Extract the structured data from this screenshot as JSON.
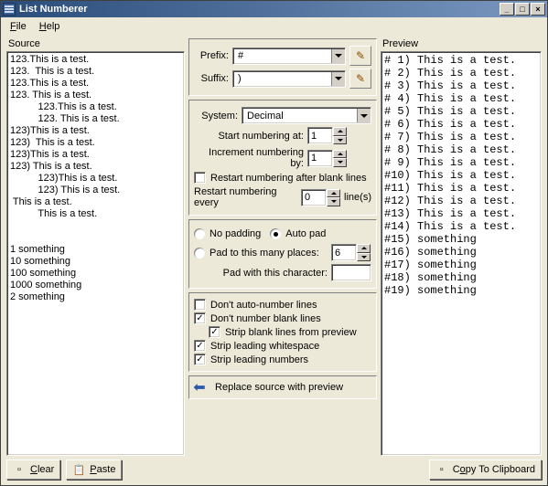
{
  "window": {
    "title": "List Numberer"
  },
  "menu": {
    "file": "File",
    "help": "Help"
  },
  "labels": {
    "source": "Source",
    "preview": "Preview",
    "prefix": "Prefix:",
    "suffix": "Suffix:",
    "system": "System:",
    "start_at": "Start numbering at:",
    "increment_by": "Increment numbering by:",
    "restart_blank": "Restart numbering after blank lines",
    "restart_every_pre": "Restart numbering every",
    "restart_every_post": "line(s)",
    "no_padding": "No padding",
    "auto_pad": "Auto pad",
    "pad_places": "Pad to this many places:",
    "pad_char": "Pad with this character:",
    "dont_auto": "Don't auto-number lines",
    "dont_blank": "Don't number blank lines",
    "strip_blank_preview": "Strip blank lines from preview",
    "strip_leading_ws": "Strip leading whitespace",
    "strip_leading_nums": "Strip leading numbers",
    "replace": "Replace source with preview"
  },
  "buttons": {
    "clear": "Clear",
    "paste": "Paste",
    "copy": "Copy To Clipboard"
  },
  "values": {
    "prefix": "#",
    "suffix": ")",
    "system": "Decimal",
    "start_at": "1",
    "increment_by": "1",
    "restart_every": "0",
    "pad_places": "6",
    "pad_char": "",
    "restart_blank": false,
    "pad_mode": "auto",
    "dont_auto": false,
    "dont_blank": true,
    "strip_blank_preview": true,
    "strip_leading_ws": true,
    "strip_leading_nums": true
  },
  "source_text": "123.This is a test.\n123.  This is a test.\n123.This is a test.\n123. This is a test.\n          123.This is a test.\n          123. This is a test.\n123)This is a test.\n123)  This is a test.\n123)This is a test.\n123) This is a test.\n          123)This is a test.\n          123) This is a test.\n This is a test.\n          This is a test.\n\n\n1 something\n10 something\n100 something\n1000 something\n2 something",
  "preview_text": "# 1) This is a test.\n# 2) This is a test.\n# 3) This is a test.\n# 4) This is a test.\n# 5) This is a test.\n# 6) This is a test.\n# 7) This is a test.\n# 8) This is a test.\n# 9) This is a test.\n#10) This is a test.\n#11) This is a test.\n#12) This is a test.\n#13) This is a test.\n#14) This is a test.\n#15) something\n#16) something\n#17) something\n#18) something\n#19) something"
}
